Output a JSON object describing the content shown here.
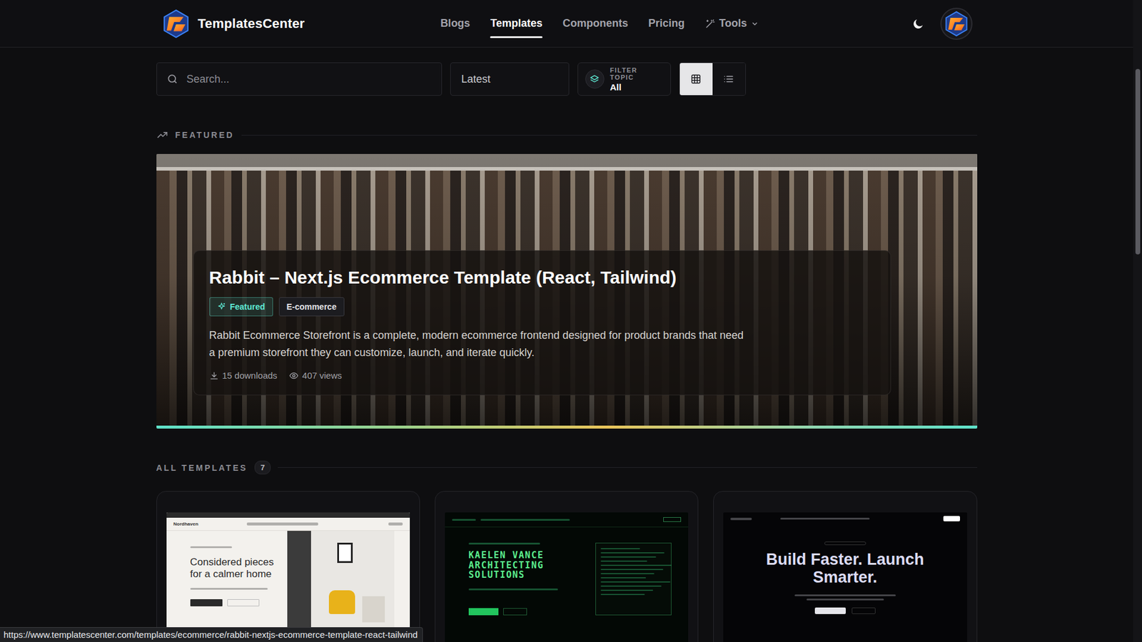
{
  "brand": {
    "name": "TemplatesCenter"
  },
  "nav": [
    {
      "label": "Blogs",
      "selected": false,
      "kind": "link"
    },
    {
      "label": "Templates",
      "selected": true,
      "kind": "link"
    },
    {
      "label": "Components",
      "selected": false,
      "kind": "link"
    },
    {
      "label": "Pricing",
      "selected": false,
      "kind": "link"
    },
    {
      "label": "Tools",
      "selected": false,
      "kind": "dropdown"
    }
  ],
  "toolbar": {
    "search": {
      "placeholder": "Search..."
    },
    "sort": "Latest",
    "filter": {
      "label": "FILTER TOPIC",
      "value": "All"
    },
    "views": [
      {
        "kind": "grid",
        "selected": true
      },
      {
        "kind": "list",
        "selected": false
      }
    ]
  },
  "featured": {
    "heading": "FEATURED",
    "title": "Rabbit – Next.js Ecommerce Template (React, Tailwind)",
    "tags": [
      {
        "label": "Featured",
        "color": "#5eead4"
      },
      {
        "label": "E-commerce",
        "color": "#3a3a3f"
      }
    ],
    "description": "Rabbit Ecommerce Storefront is a complete, modern ecommerce frontend designed for product brands that need a premium storefront they can customize, launch, and iterate quickly.",
    "downloads": "15 downloads",
    "views": "407 views"
  },
  "all_templates": {
    "heading": "ALL TEMPLATES",
    "count": "7",
    "cards": [
      {
        "kind": "light",
        "logo": "Nordhaven",
        "headline": [
          "Considered pieces",
          "for a calmer home"
        ]
      },
      {
        "kind": "terminal",
        "headline": [
          "KAELEN VANCE",
          "ARCHITECTING",
          "SOLUTIONS"
        ]
      },
      {
        "kind": "dark",
        "headline": [
          "Build Faster. Launch",
          "Smarter."
        ]
      }
    ]
  },
  "status_bar": {
    "url": "https://www.templatescenter.com/templates/ecommerce/rabbit-nextjs-ecommerce-template-react-tailwind"
  }
}
